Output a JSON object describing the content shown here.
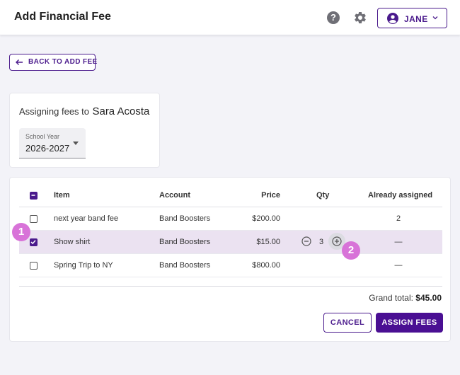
{
  "header": {
    "title": "Add Financial Fee",
    "user_label": "JANE"
  },
  "back_button": {
    "label": "BACK TO ADD FEE"
  },
  "assign": {
    "prefix": "Assigning fees to",
    "student": "Sara Acosta",
    "school_year": {
      "label": "School Year",
      "value": "2026-2027"
    }
  },
  "table": {
    "headers": {
      "item": "Item",
      "account": "Account",
      "price": "Price",
      "qty": "Qty",
      "already": "Already assigned"
    },
    "rows": [
      {
        "item": "next year band fee",
        "account": "Band Boosters",
        "price": "$200.00",
        "qty": "",
        "already": "2",
        "checked": false
      },
      {
        "item": "Show shirt",
        "account": "Band Boosters",
        "price": "$15.00",
        "qty": "3",
        "already": "—",
        "checked": true
      },
      {
        "item": "Spring Trip to NY",
        "account": "Band Boosters",
        "price": "$800.00",
        "qty": "",
        "already": "—",
        "checked": false
      }
    ]
  },
  "totals": {
    "label": "Grand total:",
    "value": "$45.00"
  },
  "actions": {
    "cancel": "CANCEL",
    "assign": "ASSIGN FEES"
  },
  "steps": {
    "one": "1",
    "two": "2"
  },
  "colors": {
    "primary": "#4a1a8c",
    "selected_row": "#ebe2f1",
    "step_badge": "#d873d8"
  }
}
